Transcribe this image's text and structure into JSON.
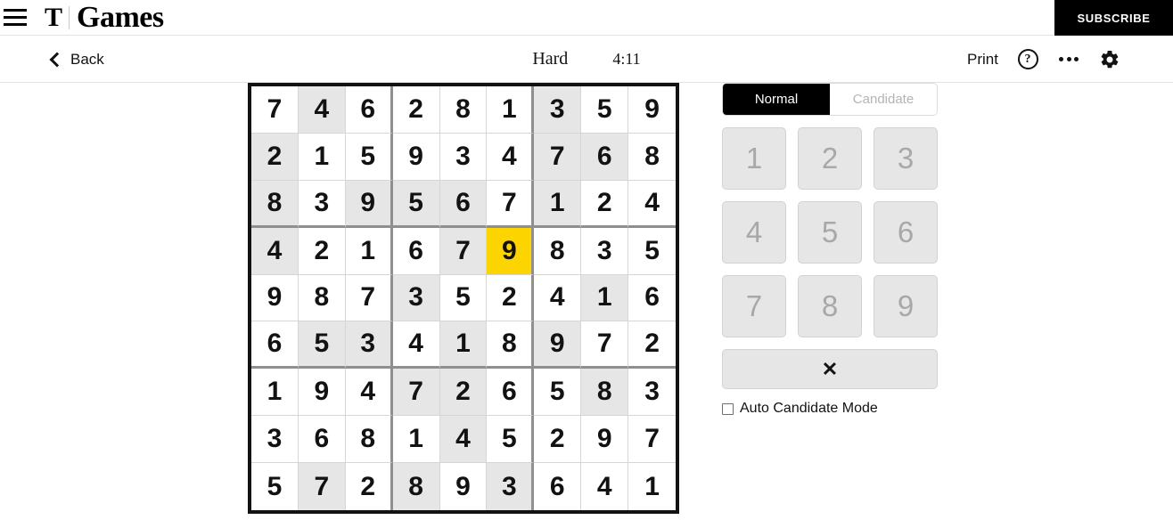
{
  "nyt_bar": {
    "menu_icon": "hamburger-menu-icon",
    "logo_mark": "T",
    "brand": "Games",
    "subscribe_label": "SUBSCRIBE"
  },
  "game_bar": {
    "back_label": "Back",
    "back_icon": "chevron-left-icon",
    "difficulty": "Hard",
    "timer": "4:11",
    "print_label": "Print",
    "help_icon": "question-mark-circle-icon",
    "more_icon": "ellipsis-icon",
    "settings_icon": "gear-icon"
  },
  "panel": {
    "modes": [
      {
        "label": "Normal",
        "active": true
      },
      {
        "label": "Candidate",
        "active": false
      }
    ],
    "numbers": [
      "1",
      "2",
      "3",
      "4",
      "5",
      "6",
      "7",
      "8",
      "9"
    ],
    "erase_label": "✕",
    "erase_icon": "erase-x-icon",
    "auto_candidate_label": "Auto Candidate Mode",
    "auto_candidate_checked": false
  },
  "colors": {
    "selected_cell": "#fcd400",
    "shaded_cell": "#e6e6e6",
    "grid_border": "#121212",
    "box_divider": "#8f8f8f",
    "cell_divider": "#d6d6d6",
    "accent_black": "#000000"
  },
  "board": {
    "selected": {
      "row": 4,
      "col": 6,
      "value": "9"
    },
    "rows": [
      [
        "7",
        "4",
        "6",
        "2",
        "8",
        "1",
        "3",
        "5",
        "9"
      ],
      [
        "2",
        "1",
        "5",
        "9",
        "3",
        "4",
        "7",
        "6",
        "8"
      ],
      [
        "8",
        "3",
        "9",
        "5",
        "6",
        "7",
        "1",
        "2",
        "4"
      ],
      [
        "4",
        "2",
        "1",
        "6",
        "7",
        "9",
        "8",
        "3",
        "5"
      ],
      [
        "9",
        "8",
        "7",
        "3",
        "5",
        "2",
        "4",
        "1",
        "6"
      ],
      [
        "6",
        "5",
        "3",
        "4",
        "1",
        "8",
        "9",
        "7",
        "2"
      ],
      [
        "1",
        "9",
        "4",
        "7",
        "2",
        "6",
        "5",
        "8",
        "3"
      ],
      [
        "3",
        "6",
        "8",
        "1",
        "4",
        "5",
        "2",
        "9",
        "7"
      ],
      [
        "5",
        "7",
        "2",
        "8",
        "9",
        "3",
        "6",
        "4",
        "1"
      ]
    ],
    "shaded": [
      [
        0,
        1,
        0,
        0,
        0,
        0,
        1,
        0,
        0
      ],
      [
        1,
        0,
        0,
        0,
        0,
        0,
        1,
        1,
        0
      ],
      [
        1,
        0,
        1,
        1,
        1,
        0,
        1,
        0,
        0
      ],
      [
        1,
        0,
        0,
        0,
        1,
        0,
        0,
        0,
        0
      ],
      [
        0,
        0,
        0,
        1,
        0,
        0,
        0,
        1,
        0
      ],
      [
        0,
        1,
        1,
        0,
        1,
        0,
        1,
        0,
        0
      ],
      [
        0,
        0,
        0,
        1,
        1,
        0,
        0,
        1,
        0
      ],
      [
        0,
        0,
        0,
        0,
        1,
        0,
        0,
        0,
        0
      ],
      [
        0,
        1,
        0,
        1,
        0,
        1,
        0,
        0,
        0
      ]
    ]
  }
}
